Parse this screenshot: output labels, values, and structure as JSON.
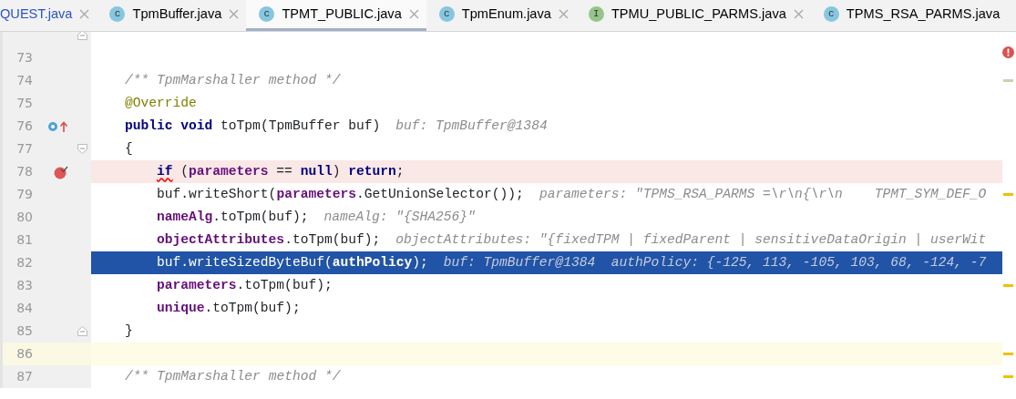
{
  "tabs": [
    {
      "label": "QUEST.java",
      "selected": false,
      "kind": "file",
      "modified": true,
      "closable": true
    },
    {
      "label": "TpmBuffer.java",
      "selected": false,
      "kind": "class",
      "icon_letter": "c",
      "closable": true
    },
    {
      "label": "TPMT_PUBLIC.java",
      "selected": true,
      "kind": "class",
      "icon_letter": "c",
      "closable": true
    },
    {
      "label": "TpmEnum.java",
      "selected": false,
      "kind": "class",
      "icon_letter": "c",
      "closable": true
    },
    {
      "label": "TPMU_PUBLIC_PARMS.java",
      "selected": false,
      "kind": "interface",
      "icon_letter": "I",
      "closable": true
    },
    {
      "label": "TPMS_RSA_PARMS.java",
      "selected": false,
      "kind": "class",
      "icon_letter": "c",
      "closable": false
    }
  ],
  "lines": [
    {
      "fold_end": true
    },
    {
      "number": "73"
    },
    {
      "number": "74",
      "info_stripe": true,
      "tokens": [
        {
          "kind": "comment",
          "text": "/** TpmMarshaller method */"
        }
      ]
    },
    {
      "number": "75",
      "tokens": [
        {
          "kind": "annotation",
          "text": "@Override"
        }
      ]
    },
    {
      "number": "76",
      "override_marker": true,
      "tokens": [
        {
          "kind": "keyword",
          "text": "public void "
        },
        {
          "kind": "plain",
          "text": "toTpm(TpmBuffer buf)"
        }
      ],
      "hint": "buf: TpmBuffer@1384"
    },
    {
      "number": "77",
      "fold_start": true,
      "tokens": [
        {
          "kind": "plain",
          "text": "{"
        }
      ]
    },
    {
      "number": "78",
      "breakpoint": true,
      "indented": true,
      "tokens": [
        {
          "kind": "keyword",
          "text": "if",
          "squiggle": true
        },
        {
          "kind": "plain",
          "text": " ("
        },
        {
          "kind": "field",
          "text": "parameters"
        },
        {
          "kind": "plain",
          "text": " == "
        },
        {
          "kind": "keyword",
          "text": "null"
        },
        {
          "kind": "plain",
          "text": ") "
        },
        {
          "kind": "keyword",
          "text": "return"
        },
        {
          "kind": "plain",
          "text": ";"
        }
      ]
    },
    {
      "number": "79",
      "warning_stripe": true,
      "indented": true,
      "tokens": [
        {
          "kind": "plain",
          "text": "buf.writeShort("
        },
        {
          "kind": "field",
          "text": "parameters"
        },
        {
          "kind": "plain",
          "text": ".GetUnionSelector());"
        }
      ],
      "hint": "parameters: \"TPMS_RSA_PARMS =\\r\\n{\\r\\n    TPMT_SYM_DEF_O"
    },
    {
      "number": "80",
      "indented": true,
      "tokens": [
        {
          "kind": "field",
          "text": "nameAlg"
        },
        {
          "kind": "plain",
          "text": ".toTpm(buf);"
        }
      ],
      "hint": "nameAlg: \"{SHA256}\""
    },
    {
      "number": "81",
      "indented": true,
      "tokens": [
        {
          "kind": "field",
          "text": "objectAttributes"
        },
        {
          "kind": "plain",
          "text": ".toTpm(buf);"
        }
      ],
      "hint": "objectAttributes: \"{fixedTPM | fixedParent | sensitiveDataOrigin | userWit"
    },
    {
      "number": "82",
      "execution_point": true,
      "indented": true,
      "tokens": [
        {
          "kind": "plain",
          "text": "buf.writeSizedByteBuf("
        },
        {
          "kind": "field",
          "text": "authPolicy"
        },
        {
          "kind": "plain",
          "text": ");"
        }
      ],
      "hint": "buf: TpmBuffer@1384  authPolicy: {-125, 113, -105, 103, 68, -124, -7"
    },
    {
      "number": "83",
      "warning_stripe": true,
      "indented": true,
      "tokens": [
        {
          "kind": "field",
          "text": "parameters"
        },
        {
          "kind": "plain",
          "text": ".toTpm(buf);"
        }
      ]
    },
    {
      "number": "84",
      "indented": true,
      "tokens": [
        {
          "kind": "field",
          "text": "unique"
        },
        {
          "kind": "plain",
          "text": ".toTpm(buf);"
        }
      ]
    },
    {
      "number": "85",
      "fold_end": true,
      "tokens": [
        {
          "kind": "plain",
          "text": "}"
        }
      ]
    },
    {
      "number": "86",
      "current_line": true,
      "warning_stripe": true
    },
    {
      "number": "87",
      "warning_stripe": true,
      "tokens": [
        {
          "kind": "comment",
          "text": "/** TpmMarshaller method */"
        }
      ]
    }
  ],
  "error_indicator": true
}
